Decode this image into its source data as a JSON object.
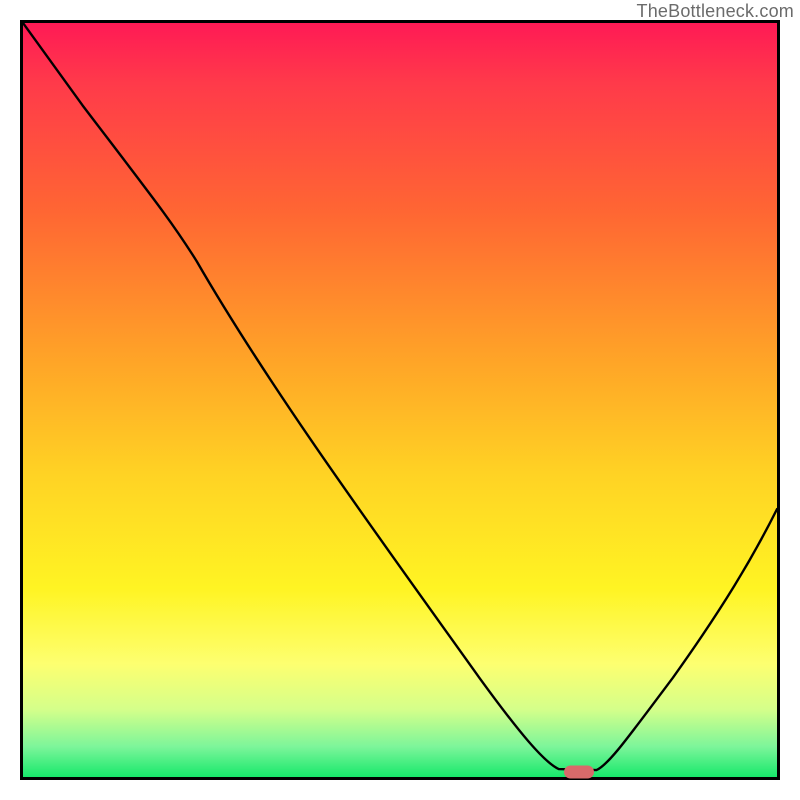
{
  "watermark": "TheBottleneck.com",
  "marker": {
    "x_pct": 73.8,
    "y_pct": 99.3
  },
  "chart_data": {
    "type": "line",
    "title": "",
    "xlabel": "",
    "ylabel": "",
    "xlim": [
      0,
      100
    ],
    "ylim": [
      0,
      100
    ],
    "grid": false,
    "series": [
      {
        "name": "bottleneck-curve",
        "x": [
          0,
          8,
          20,
          30,
          42,
          55,
          65,
          70,
          73,
          76,
          78,
          85,
          92,
          100
        ],
        "y": [
          100,
          89,
          75,
          68,
          52,
          34,
          18,
          6,
          1,
          1,
          2,
          12,
          25,
          40
        ]
      }
    ],
    "annotations": [
      {
        "name": "optimal-marker",
        "x": 73.8,
        "y": 0.7
      }
    ],
    "background": {
      "gradient_stops": [
        {
          "pct": 0,
          "color": "#ff1a55"
        },
        {
          "pct": 25,
          "color": "#ff6633"
        },
        {
          "pct": 60,
          "color": "#ffd324"
        },
        {
          "pct": 85,
          "color": "#fdff70"
        },
        {
          "pct": 100,
          "color": "#17e86b"
        }
      ]
    }
  }
}
